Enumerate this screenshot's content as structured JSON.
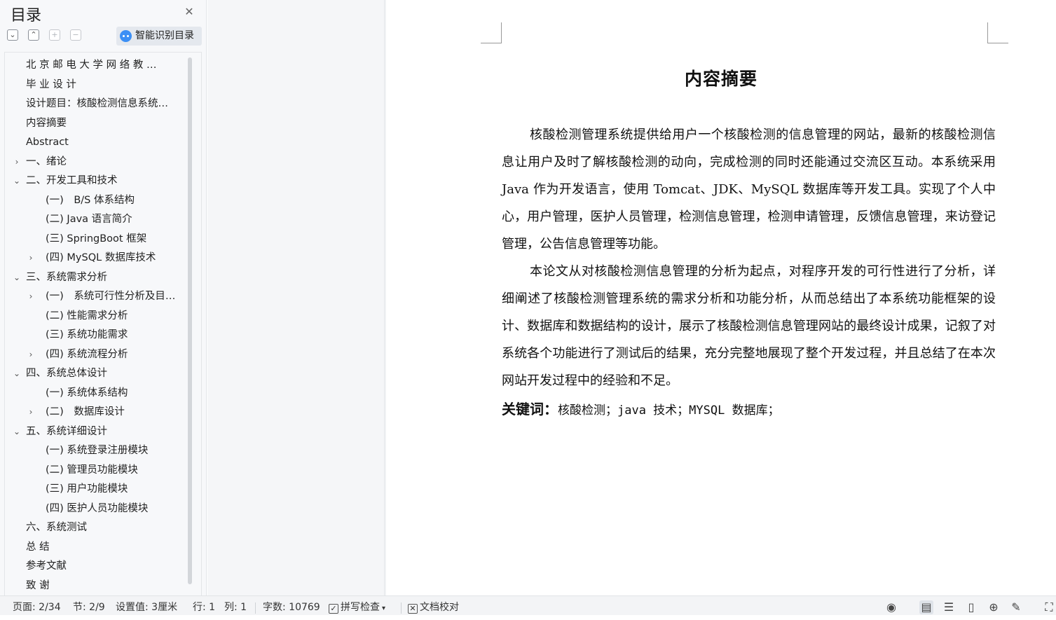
{
  "sidebar": {
    "title": "目录",
    "smart_toc_label": "智能识别目录",
    "items": [
      {
        "label": "北 京 邮 电 大 学 网 络 教 …",
        "arrow": ""
      },
      {
        "label": "毕 业 设 计",
        "arrow": ""
      },
      {
        "label": "设计题目：核酸检测信息系统…",
        "arrow": ""
      },
      {
        "label": "内容摘要",
        "arrow": ""
      },
      {
        "label": "Abstract",
        "arrow": ""
      },
      {
        "label": "一、绪论",
        "arrow": "›"
      },
      {
        "label": "二、开发工具和技术",
        "arrow": "⌄"
      },
      {
        "label": "(一)　B/S 体系结构",
        "arrow": ""
      },
      {
        "label": "(二) Java 语言简介",
        "arrow": ""
      },
      {
        "label": "(三) SpringBoot 框架",
        "arrow": ""
      },
      {
        "label": "(四) MySQL 数据库技术",
        "arrow": "›"
      },
      {
        "label": "三、系统需求分析",
        "arrow": "⌄"
      },
      {
        "label": "(一)　系统可行性分析及目…",
        "arrow": "›"
      },
      {
        "label": "(二) 性能需求分析",
        "arrow": ""
      },
      {
        "label": "(三) 系统功能需求",
        "arrow": ""
      },
      {
        "label": "(四) 系统流程分析",
        "arrow": "›"
      },
      {
        "label": "四、系统总体设计",
        "arrow": "⌄"
      },
      {
        "label": "(一) 系统体系结构",
        "arrow": ""
      },
      {
        "label": "(二)　数据库设计",
        "arrow": "›"
      },
      {
        "label": "五、系统详细设计",
        "arrow": "⌄"
      },
      {
        "label": "(一) 系统登录注册模块",
        "arrow": ""
      },
      {
        "label": "(二) 管理员功能模块",
        "arrow": ""
      },
      {
        "label": "(三) 用户功能模块",
        "arrow": ""
      },
      {
        "label": "(四) 医护人员功能模块",
        "arrow": ""
      },
      {
        "label": "六、系统测试",
        "arrow": ""
      },
      {
        "label": "总 结",
        "arrow": ""
      },
      {
        "label": "参考文献",
        "arrow": ""
      },
      {
        "label": "致 谢",
        "arrow": ""
      }
    ]
  },
  "document": {
    "title": "内容摘要",
    "paragraphs": [
      "核酸检测管理系统提供给用户一个核酸检测的信息管理的网站，最新的核酸检测信息让用户及时了解核酸检测的动向，完成检测的同时还能通过交流区互动。本系统采用 Java 作为开发语言，使用 Tomcat、JDK、MySQL 数据库等开发工具。实现了个人中心，用户管理，医护人员管理，检测信息管理，检测申请管理，反馈信息管理，来访登记管理，公告信息管理等功能。",
      "本论文从对核酸检测信息管理的分析为起点，对程序开发的可行性进行了分析，详细阐述了核酸检测管理系统的需求分析和功能分析，从而总结出了本系统功能框架的设计、数据库和数据结构的设计，展示了核酸检测信息管理网站的最终设计成果，记叙了对系统各个功能进行了测试后的结果，充分完整地展现了整个开发过程，并且总结了在本次网站开发过程中的经验和不足。"
    ],
    "keywords_label": "关键词：",
    "keywords_value": "核酸检测；java 技术；MYSQL 数据库；"
  },
  "status": {
    "page": "页面: 2/34",
    "section": "节: 2/9",
    "setting": "设置值: 3厘米",
    "row": "行: 1",
    "col": "列: 1",
    "word_count": "字数: 10769",
    "spell_check": "拼写检查",
    "doc_proof": "文档校对"
  }
}
